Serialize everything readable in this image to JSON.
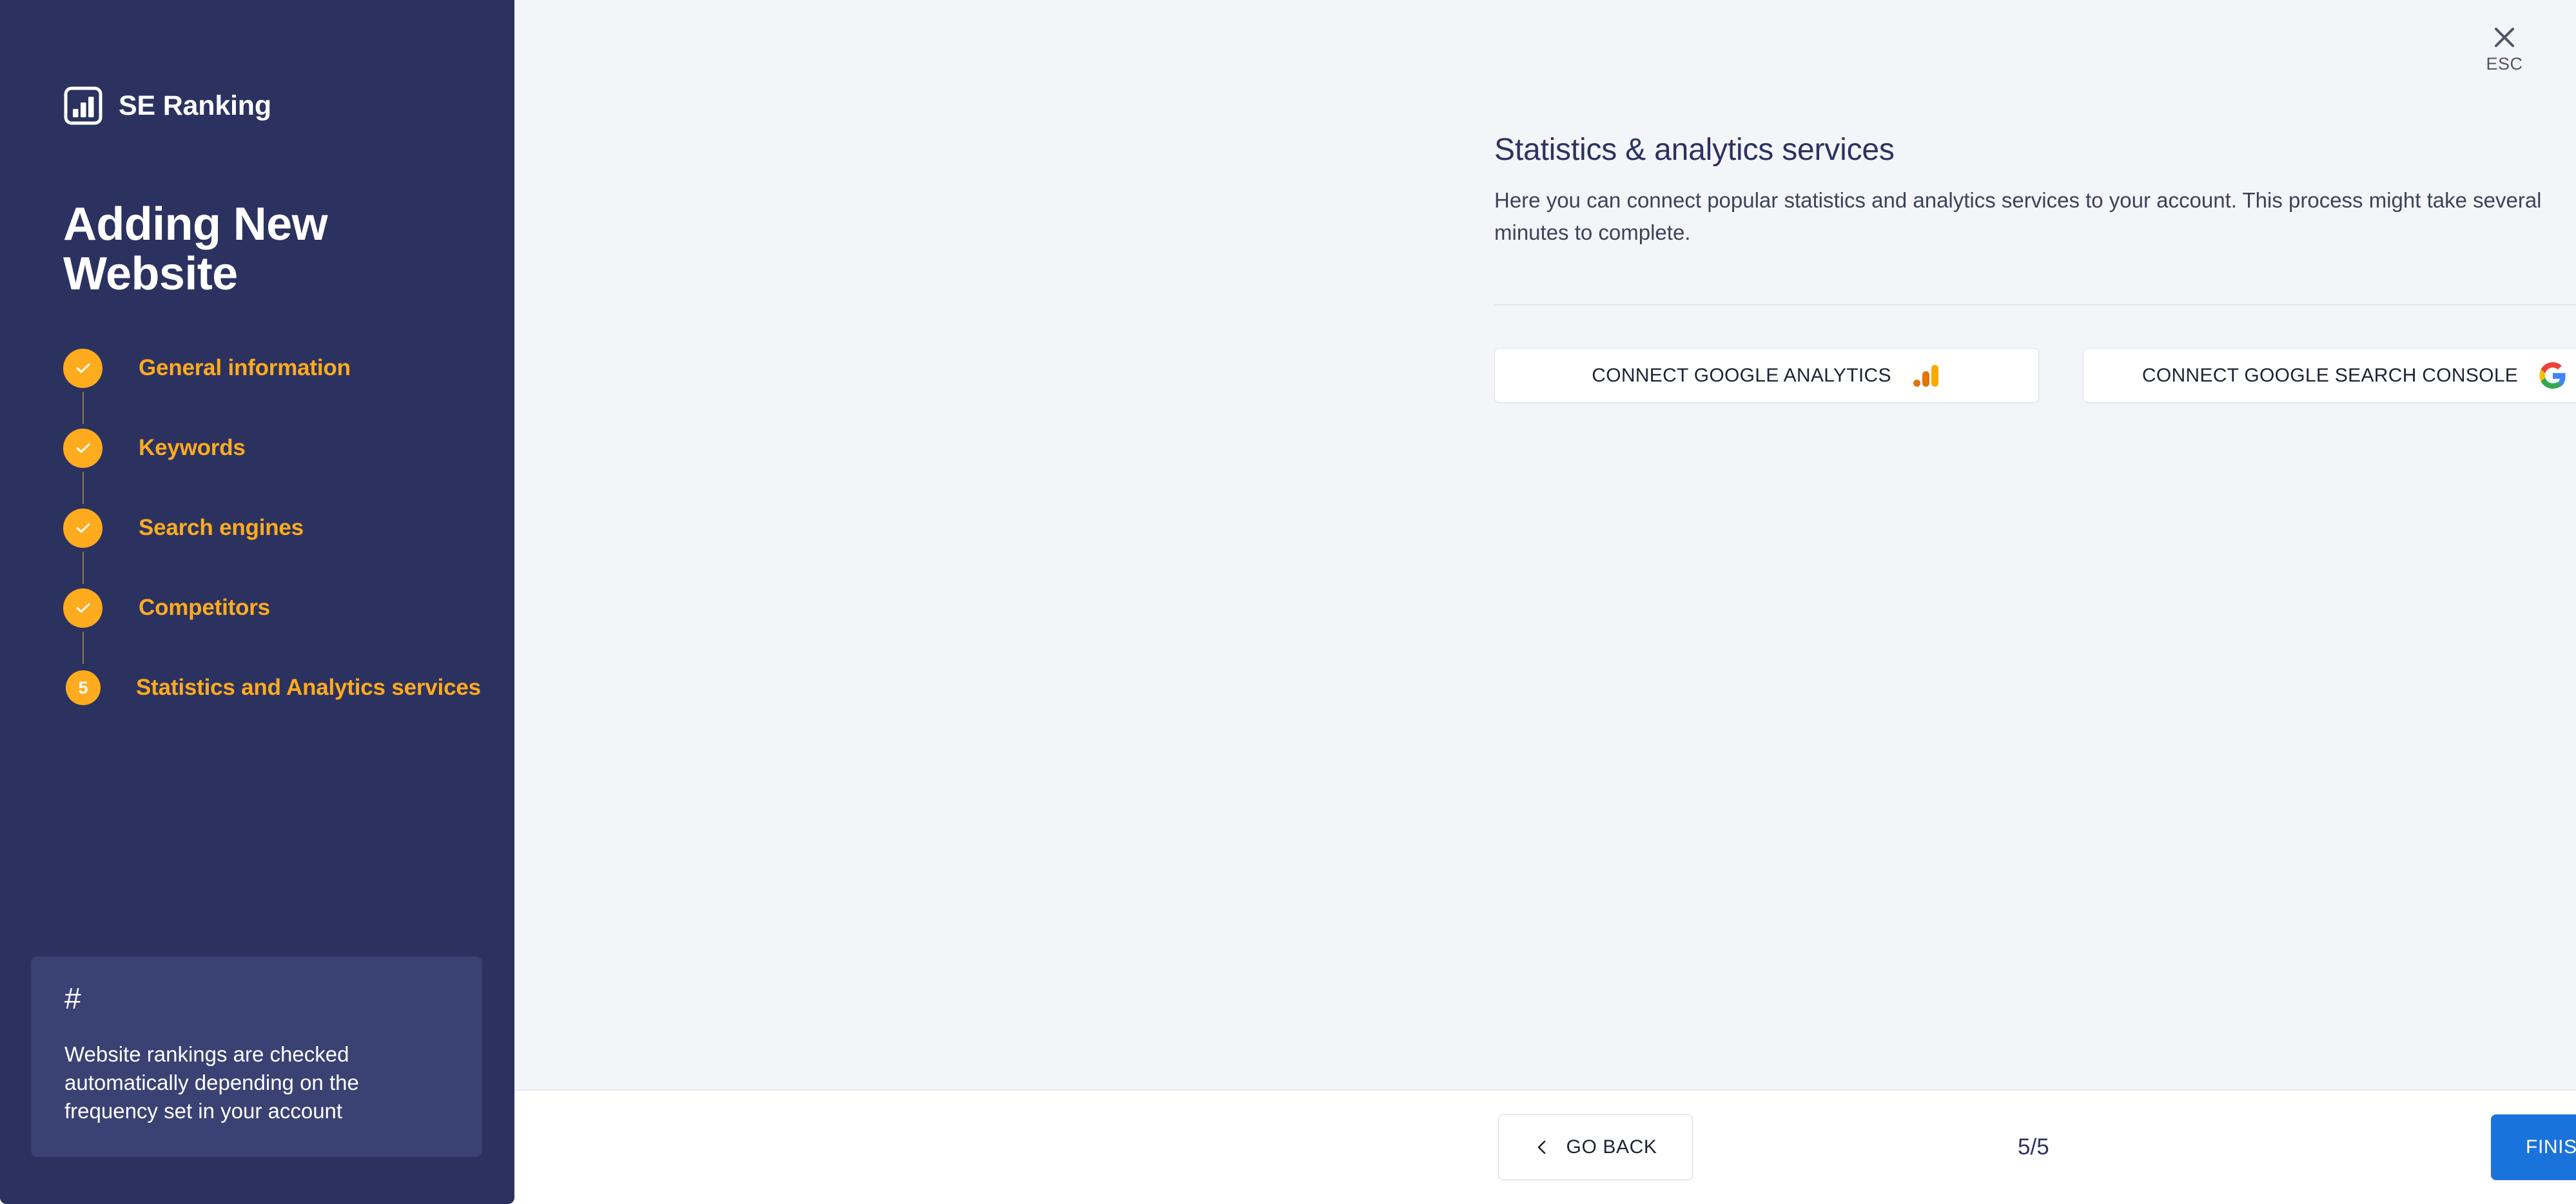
{
  "sidebar": {
    "brand_name": "SE Ranking",
    "brand_icon": "bar-chart-logo-icon",
    "wizard_title": "Adding New Website",
    "steps": [
      {
        "number": "1",
        "label": "General information",
        "state": "completed",
        "icon": "check-icon"
      },
      {
        "number": "2",
        "label": "Keywords",
        "state": "completed",
        "icon": "check-icon"
      },
      {
        "number": "3",
        "label": "Search engines",
        "state": "completed",
        "icon": "check-icon"
      },
      {
        "number": "4",
        "label": "Competitors",
        "state": "completed",
        "icon": "check-icon"
      },
      {
        "number": "5",
        "label": "Statistics and Analytics services",
        "state": "current",
        "icon": "number-badge"
      }
    ],
    "tip": {
      "icon": "hash-icon",
      "symbol": "#",
      "text": "Website rankings are checked automatically depending on the frequency set in your account"
    }
  },
  "header": {
    "close_icon": "close-x-icon",
    "close_label": "ESC"
  },
  "main": {
    "title": "Statistics & analytics services",
    "description": "Here you can connect popular statistics and analytics services to your account. This process might take several minutes to complete.",
    "services": [
      {
        "label": "CONNECT GOOGLE ANALYTICS",
        "icon": "google-analytics-icon"
      },
      {
        "label": "CONNECT GOOGLE SEARCH CONSOLE",
        "icon": "google-g-icon"
      }
    ]
  },
  "footer": {
    "back_label": "GO BACK",
    "back_icon": "chevron-left-icon",
    "step_counter": "5/5",
    "finish_label": "FINISH"
  },
  "colors": {
    "sidebar_bg": "#2c3260",
    "tip_bg": "#3a4173",
    "accent_amber": "#ffab1e",
    "primary_blue": "#1a73db",
    "page_bg": "#f4f5f9",
    "title_navy": "#2c3260"
  }
}
